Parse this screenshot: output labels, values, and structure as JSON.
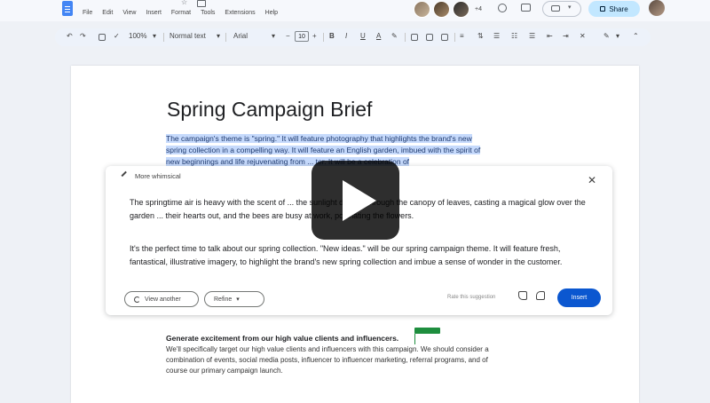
{
  "app": {
    "menu": [
      "File",
      "Edit",
      "View",
      "Insert",
      "Format",
      "Tools",
      "Extensions",
      "Help"
    ],
    "collaborators_more": "+4",
    "share_label": "Share"
  },
  "toolbar": {
    "zoom": "100%",
    "style": "Normal text",
    "font": "Arial",
    "size": "10",
    "bold": "B",
    "italic": "I",
    "underline": "U",
    "text_color": "A"
  },
  "document": {
    "title": "Spring Campaign Brief",
    "highlighted_lines": [
      "The campaign's theme is \"spring.\" It will feature photography that highlights the brand's new",
      "spring collection in a compelling way. It will feature an English garden, imbued with the spirit of",
      "new beginnings and life rejuvenating from ... ter. It will be a celebration of"
    ],
    "subheading": "Generate excitement from our high value clients and influencers.",
    "body_lines": [
      "We'll specifically target our high value clients and influencers with this campaign. We should consider a",
      "combination of events, social media posts, influencer to influencer marketing, referral programs, and of",
      "course our primary campaign launch."
    ]
  },
  "help_me_write": {
    "prompt": "More whimsical",
    "paragraph1": "The springtime air is heavy with the scent of ... the sunlight dances through the canopy of leaves, casting a magical glow over the garden ... their hearts out, and the bees are busy at work, pollinating the flowers.",
    "paragraph2": "It's the perfect time to talk about our spring collection. \"New ideas.\" will be our spring campaign theme. It will feature fresh, fantastical, illustrative imagery, to highlight the brand's new spring collection and imbue a sense of wonder in the customer.",
    "view_another": "View another",
    "refine": "Refine",
    "feedback": "Rate this suggestion",
    "insert": "Insert"
  },
  "colors": {
    "accent": "#0b57d0",
    "highlight": "#c6dafc",
    "share": "#c2e7ff",
    "collaborator_cursor": "#1e8e3e"
  },
  "icons": [
    "docs-logo-icon",
    "star-icon",
    "folder-icon",
    "history-icon",
    "comment-icon",
    "meet-icon",
    "lock-icon",
    "wand-icon",
    "close-icon",
    "refresh-icon",
    "thumb-up-icon",
    "thumb-down-icon",
    "play-icon"
  ]
}
